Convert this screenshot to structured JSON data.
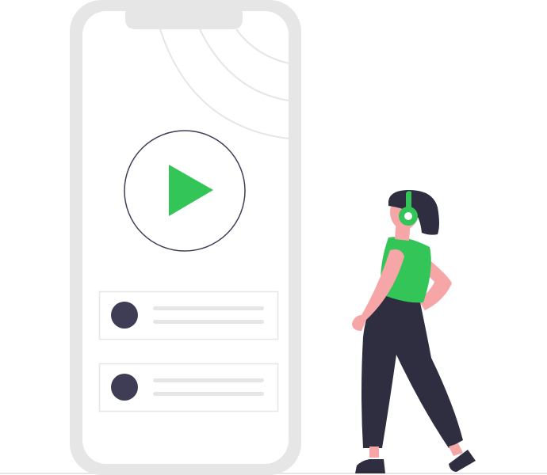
{
  "colors": {
    "phone_frame": "#e6e6e6",
    "phone_screen": "#ffffff",
    "accent_green": "#33c558",
    "dark_navy": "#3f3d56",
    "skin": "#f6a6a6",
    "clothing_dark": "#2f2e41",
    "list_line": "#e6e6e6",
    "wave_line": "#e6e6e6"
  },
  "icons": {
    "play": "play-icon",
    "headphones": "headphones-icon",
    "sound_waves": "sound-waves-icon"
  },
  "playlist": {
    "items": [
      {
        "avatar": "track-avatar"
      },
      {
        "avatar": "track-avatar"
      }
    ]
  }
}
